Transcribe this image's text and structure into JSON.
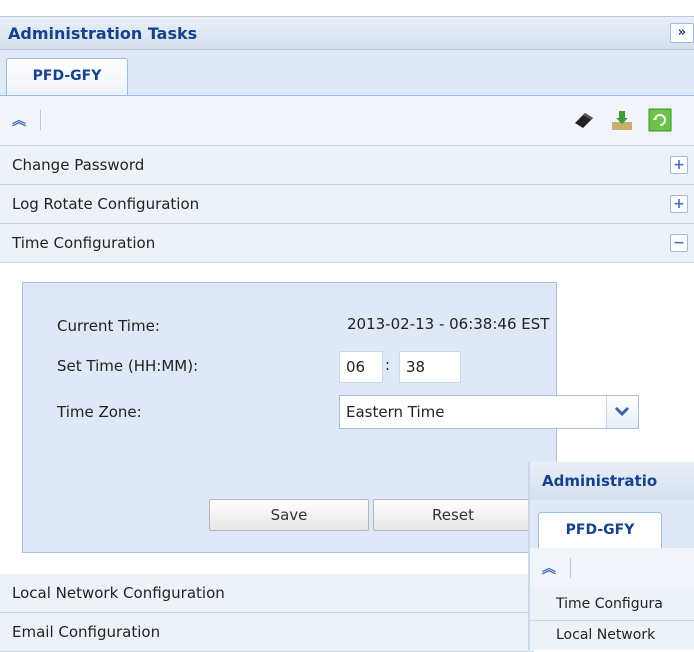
{
  "panel": {
    "title": "Administration Tasks",
    "collapse_glyph": "»"
  },
  "tabs": [
    {
      "label": "PFD-GFY"
    }
  ],
  "toolbar": {
    "collapse_all_glyph": "︽",
    "icons": [
      "eraser-icon",
      "download-icon",
      "refresh-icon"
    ]
  },
  "sections": [
    {
      "label": "Change Password",
      "toggle": "+"
    },
    {
      "label": "Log Rotate Configuration",
      "toggle": "+"
    },
    {
      "label": "Time Configuration",
      "toggle": "−"
    }
  ],
  "time_config": {
    "current_time_label": "Current Time:",
    "current_time_value": "2013-02-13 - 06:38:46 EST",
    "set_time_label": "Set Time (HH:MM):",
    "hours": "06",
    "separator": ":",
    "minutes": "38",
    "timezone_label": "Time Zone:",
    "timezone_value": "Eastern Time",
    "save_label": "Save",
    "reset_label": "Reset"
  },
  "bottom_sections": [
    {
      "label": "Local Network Configuration"
    },
    {
      "label": "Email Configuration"
    }
  ],
  "secondary_window": {
    "title": "Administratio",
    "tab_label": "PFD-GFY",
    "collapse_all_glyph": "︽",
    "rows": [
      {
        "label": "Time Configura"
      },
      {
        "label": "Local Network"
      }
    ]
  },
  "colors": {
    "accent": "#15428b",
    "panel_bg": "#dfe8f6",
    "row_bg": "#edf2f9"
  }
}
